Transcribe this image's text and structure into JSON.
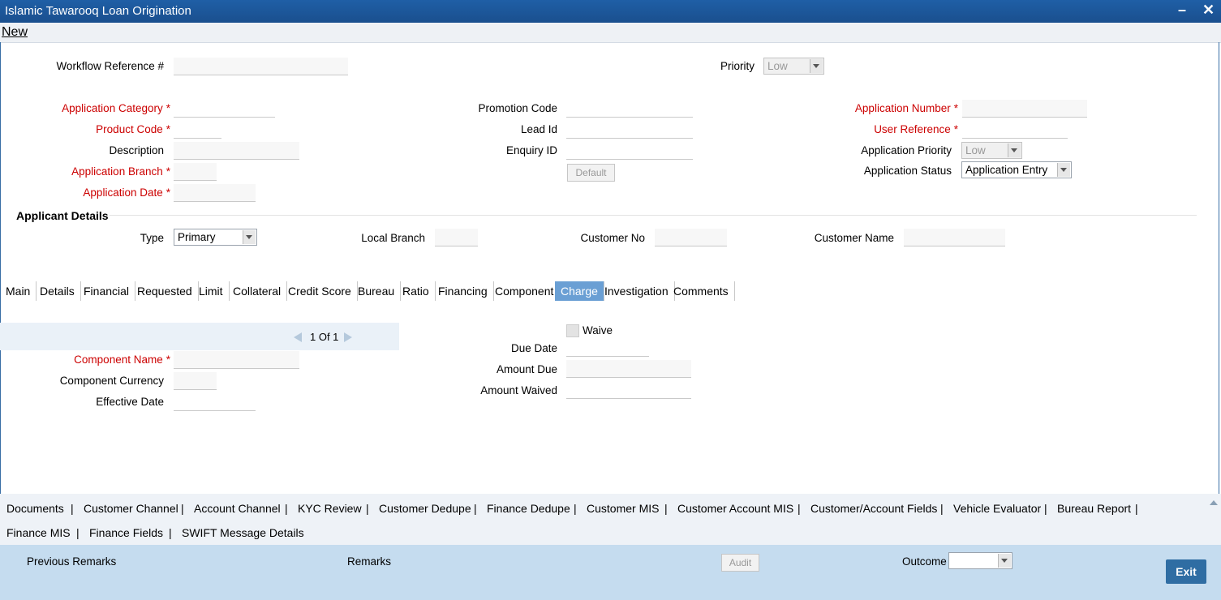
{
  "window": {
    "title": "Islamic Tawarooq Loan Origination",
    "minimize": "–",
    "close": "✕"
  },
  "menu": {
    "new_label": "New"
  },
  "header": {
    "workflow_ref_label": "Workflow Reference #",
    "workflow_ref_value": "",
    "priority_label": "Priority",
    "priority_value": "Low"
  },
  "app": {
    "category_label": "Application Category",
    "product_code_label": "Product Code",
    "description_label": "Description",
    "branch_label": "Application Branch",
    "date_label": "Application Date",
    "promotion_code_label": "Promotion Code",
    "lead_id_label": "Lead Id",
    "enquiry_id_label": "Enquiry ID",
    "default_button": "Default",
    "app_number_label": "Application Number",
    "user_ref_label": "User Reference",
    "app_priority_label": "Application Priority",
    "app_priority_value": "Low",
    "app_status_label": "Application Status",
    "app_status_value": "Application Entry",
    "required_mark": "*"
  },
  "applicant": {
    "section_title": "Applicant Details",
    "type_label": "Type",
    "type_value": "Primary",
    "local_branch_label": "Local Branch",
    "customer_no_label": "Customer No",
    "customer_name_label": "Customer Name"
  },
  "tabs": [
    "Main",
    "Details",
    "Financial",
    "Requested",
    "Limit",
    "Collateral",
    "Credit Score",
    "Bureau",
    "Ratio",
    "Financing",
    "Component",
    "Charge",
    "Investigation",
    "Comments"
  ],
  "active_tab": "Charge",
  "charge": {
    "pager_text": "1 Of 1",
    "component_name_label": "Component Name",
    "component_currency_label": "Component Currency",
    "effective_date_label": "Effective Date",
    "waive_label": "Waive",
    "due_date_label": "Due Date",
    "amount_due_label": "Amount Due",
    "amount_waived_label": "Amount Waived"
  },
  "bottom_links_row1": [
    "Documents",
    "Customer Channel",
    "Account Channel",
    "KYC Review",
    "Customer Dedupe",
    "Finance Dedupe",
    "Customer MIS",
    "Customer Account MIS",
    "Customer/Account Fields",
    "Vehicle Evaluator",
    "Bureau Report"
  ],
  "bottom_links_row2": [
    "Finance MIS",
    "Finance Fields",
    "SWIFT Message Details"
  ],
  "separator": "|",
  "footer": {
    "previous_remarks_label": "Previous Remarks",
    "remarks_label": "Remarks",
    "audit_button": "Audit",
    "outcome_label": "Outcome",
    "outcome_value": "",
    "exit_button": "Exit"
  },
  "colors": {
    "titlebar": "#1f5fa6",
    "required": "#cc0000",
    "active_tab": "#6a9fd4",
    "footer": "#c5dcef",
    "exit": "#2f6da3"
  }
}
